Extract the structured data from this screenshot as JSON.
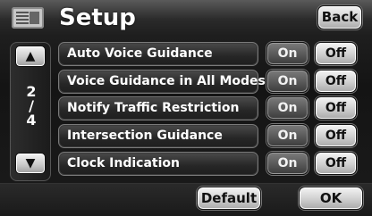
{
  "header": {
    "title": "Setup",
    "back_label": "Back",
    "menu_icon": "menu-list-icon"
  },
  "pager": {
    "current": "2",
    "separator": "/",
    "total": "4",
    "up_icon": "up-arrow-icon",
    "down_icon": "down-arrow-icon"
  },
  "settings": [
    {
      "label": "Auto Voice Guidance",
      "on_label": "On",
      "off_label": "Off",
      "selected": "on"
    },
    {
      "label": "Voice Guidance in All Modes",
      "on_label": "On",
      "off_label": "Off",
      "selected": "on"
    },
    {
      "label": "Notify Traffic Restriction",
      "on_label": "On",
      "off_label": "Off",
      "selected": "on"
    },
    {
      "label": "Intersection Guidance",
      "on_label": "On",
      "off_label": "Off",
      "selected": "on"
    },
    {
      "label": "Clock Indication",
      "on_label": "On",
      "off_label": "Off",
      "selected": "on"
    }
  ],
  "footer": {
    "default_label": "Default",
    "ok_label": "OK"
  }
}
